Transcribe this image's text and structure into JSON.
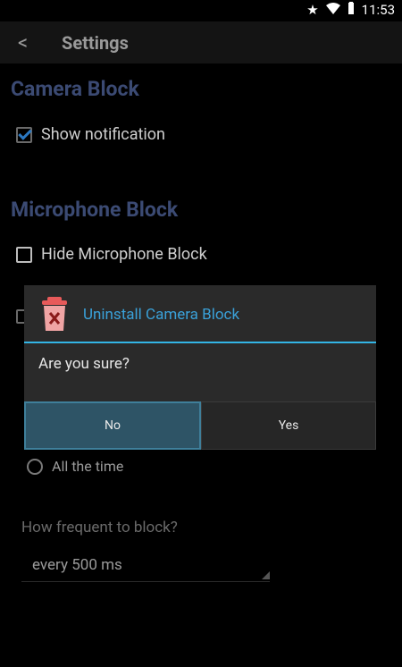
{
  "status": {
    "time": "11:53",
    "icons": [
      "star-icon",
      "wifi-icon",
      "battery-icon"
    ]
  },
  "actionbar": {
    "back": "<",
    "title": "Settings"
  },
  "camera_block": {
    "title": "Camera Block",
    "show_notification": {
      "label": "Show notification",
      "checked": true
    }
  },
  "microphone_block": {
    "title": "Microphone Block",
    "hide": {
      "label": "Hide Microphone Block",
      "checked": false
    }
  },
  "when": {
    "option_all_time": "All the time"
  },
  "frequency": {
    "label": "How frequent to block?",
    "value": "every 500 ms"
  },
  "dialog": {
    "title": "Uninstall Camera Block",
    "message": "Are you sure?",
    "no_label": "No",
    "yes_label": "Yes"
  }
}
